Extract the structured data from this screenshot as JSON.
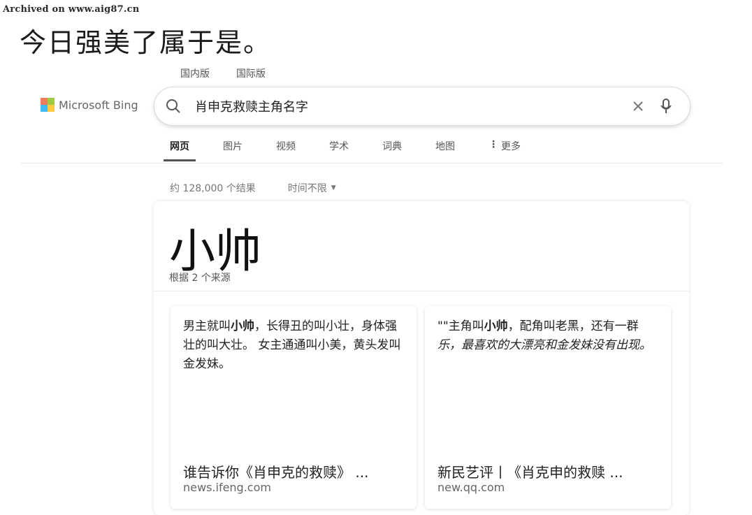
{
  "watermark": "Archived on www.aig87.cn",
  "caption": "今日强美了属于是。",
  "region_tabs": [
    "国内版",
    "国际版"
  ],
  "logo_text": "Microsoft Bing",
  "search": {
    "query": "肖申克救赎主角名字"
  },
  "nav": [
    "网页",
    "图片",
    "视频",
    "学术",
    "词典",
    "地图"
  ],
  "nav_more": "更多",
  "results_count": "约 128,000 个结果",
  "time_filter": "时间不限",
  "answer": {
    "title": "小帅",
    "subtitle": "根据 2 个来源"
  },
  "sources": [
    {
      "pre": "男主就叫",
      "bold": "小帅",
      "post": "，长得丑的叫小壮，身体强壮的叫大壮。 女主通通叫小美，黄头发叫金发妹。",
      "title": "谁告诉你《肖申克的救赎》 ...",
      "domain": "news.ifeng.com"
    },
    {
      "pre": "\"\"主角叫",
      "bold": "小帅",
      "post": "，配角叫老黑，还有一群",
      "italic": "乐，最喜欢的大漂亮和金发妹没有出现。",
      "title": "新民艺评丨《肖克申的救赎 ...",
      "domain": "new.qq.com"
    }
  ],
  "colors": {
    "accent": "#555555",
    "text": "#222222"
  }
}
